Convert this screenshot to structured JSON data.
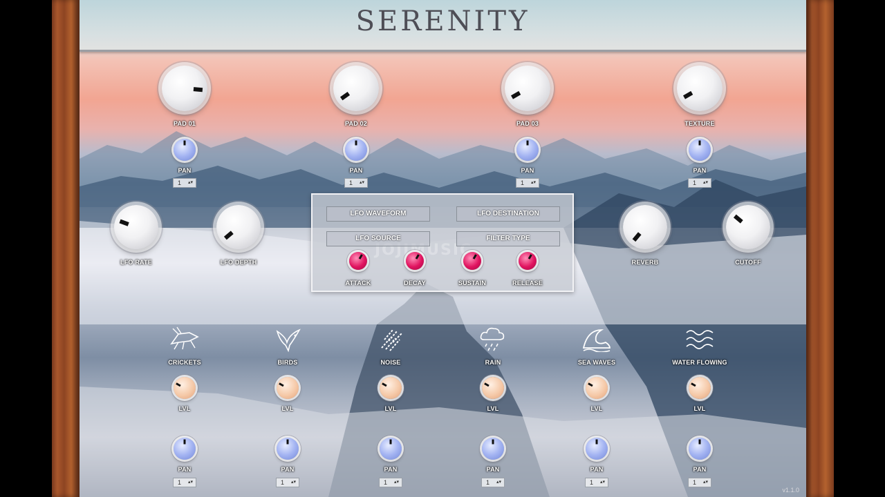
{
  "app": {
    "title": "SERENITY",
    "version": "v1.1.0",
    "watermark": "JOJIMUSIC"
  },
  "pads": [
    {
      "label": "PAD 01",
      "pan_label": "PAN",
      "channel": "1",
      "knob_angle": 5
    },
    {
      "label": "PAD 02",
      "pan_label": "PAN",
      "channel": "1",
      "knob_angle": 145
    },
    {
      "label": "PAD 03",
      "pan_label": "PAN",
      "channel": "1",
      "knob_angle": 150
    },
    {
      "label": "TEXTURE",
      "pan_label": "PAN",
      "channel": "1",
      "knob_angle": 150
    }
  ],
  "side_knobs": [
    {
      "label": "LFO RATE",
      "knob_angle": 200
    },
    {
      "label": "LFO DEPTH",
      "knob_angle": 140
    },
    {
      "label": "REVERB",
      "knob_angle": 130
    },
    {
      "label": "CUTOFF",
      "knob_angle": 220
    }
  ],
  "lfo_panel": {
    "waveform": "LFO WAVEFORM",
    "destination": "LFO DESTINATION",
    "source": "LFO SOURCE",
    "filter_type": "FILTER TYPE",
    "envelope": [
      {
        "label": "ATTACK"
      },
      {
        "label": "DECAY"
      },
      {
        "label": "SUSTAIN"
      },
      {
        "label": "RELEASE"
      }
    ]
  },
  "ambience": [
    {
      "label": "CRICKETS",
      "icon": "cricket-icon",
      "lvl_label": "LVL",
      "pan_label": "PAN",
      "channel": "1"
    },
    {
      "label": "BIRDS",
      "icon": "bird-icon",
      "lvl_label": "LVL",
      "pan_label": "PAN",
      "channel": "1"
    },
    {
      "label": "NOISE",
      "icon": "noise-icon",
      "lvl_label": "LVL",
      "pan_label": "PAN",
      "channel": "1"
    },
    {
      "label": "RAIN",
      "icon": "rain-cloud-icon",
      "lvl_label": "LVL",
      "pan_label": "PAN",
      "channel": "1"
    },
    {
      "label": "SEA WAVES",
      "icon": "sea-wave-icon",
      "lvl_label": "LVL",
      "pan_label": "PAN",
      "channel": "1"
    },
    {
      "label": "WATER FLOWING",
      "icon": "water-flow-icon",
      "lvl_label": "LVL",
      "pan_label": "PAN",
      "channel": "1"
    }
  ],
  "colors": {
    "pan_knob": "#a4b4f2",
    "lvl_knob": "#f5c9a8",
    "env_knob": "#e0135f",
    "wood": "#a8572c"
  }
}
